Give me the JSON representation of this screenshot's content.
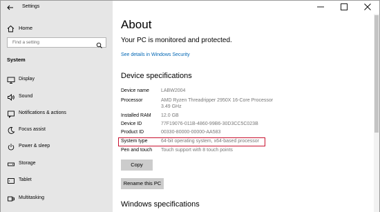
{
  "window": {
    "title": "Settings",
    "controls": [
      "minimize",
      "maximize",
      "close"
    ]
  },
  "sidebar": {
    "home_label": "Home",
    "search_placeholder": "Find a setting",
    "section_heading": "System",
    "items": [
      {
        "label": "Display",
        "icon": "display-icon"
      },
      {
        "label": "Sound",
        "icon": "speaker-icon"
      },
      {
        "label": "Notifications & actions",
        "icon": "notifications-icon"
      },
      {
        "label": "Focus assist",
        "icon": "moon-icon"
      },
      {
        "label": "Power & sleep",
        "icon": "power-icon"
      },
      {
        "label": "Storage",
        "icon": "storage-icon"
      },
      {
        "label": "Tablet",
        "icon": "tablet-icon"
      },
      {
        "label": "Multitasking",
        "icon": "multitasking-icon"
      }
    ]
  },
  "main": {
    "title": "About",
    "protection_status": "Your PC is monitored and protected.",
    "security_link": "See details in Windows Security",
    "device_specs_title": "Device specifications",
    "specs": [
      {
        "label": "Device name",
        "value": "LABW2004"
      },
      {
        "label": "Processor",
        "value": "AMD Ryzen Threadripper 2950X 16-Core Processor",
        "value2": "3.49 GHz"
      },
      {
        "label": "Installed RAM",
        "value": "12.0 GB"
      },
      {
        "label": "Device ID",
        "value": "77F19076-011B-4860-99B6-30D3CC5C023B"
      },
      {
        "label": "Product ID",
        "value": "00330-80000-00000-AA583"
      },
      {
        "label": "System type",
        "value": "64-bit operating system, x64-based processor"
      },
      {
        "label": "Pen and touch",
        "value": "Touch support with 8 touch points"
      }
    ],
    "copy_label": "Copy",
    "rename_label": "Rename this PC",
    "windows_specs_title": "Windows specifications",
    "highlight_color": "#c8102e",
    "link_color": "#0066b4"
  }
}
